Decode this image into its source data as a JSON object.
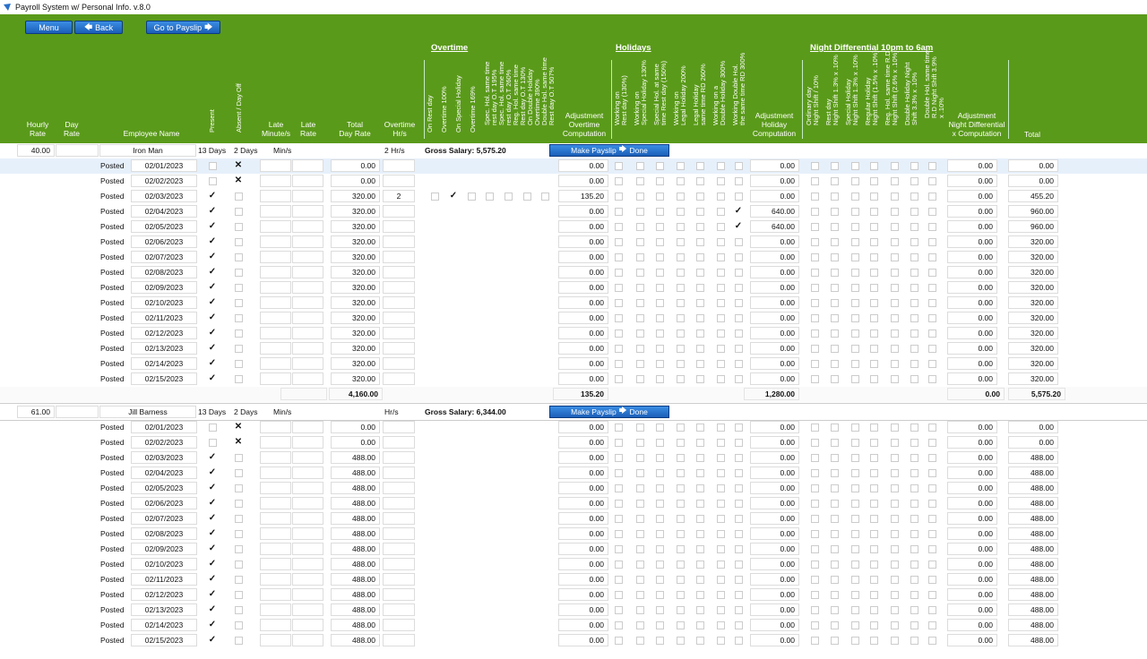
{
  "window": {
    "title": "Payroll System w/ Personal Info. v.8.0"
  },
  "nav": {
    "menu": "Menu",
    "back": "Back",
    "payslip": "Go to Payslip"
  },
  "header": {
    "cols": {
      "hourly": "Hourly\nRate",
      "day": "Day\nRate",
      "name": "Employee Name",
      "present": "Present",
      "absent": "Absent / Day Off",
      "late_min": "Late\nMinute/s",
      "late_rate": "Late\nRate",
      "total_day": "Total\nDay Rate",
      "ot_hrs": "Overtime\nHr/s",
      "adj_ot": "Adjustment\nOvertime\nComputation",
      "adj_hol": "Adjustment\nHoliday\nComputation",
      "adj_nd": "Adjustment\nNight Differential\nx Computation",
      "total": "Total"
    },
    "sections": {
      "overtime": "Overtime",
      "holidays": "Holidays",
      "night": "Night Differential 10pm to 6am"
    },
    "ot_rot": [
      [
        "On Rest day"
      ],
      [
        "Overtime 100%"
      ],
      [
        "On Special Holiday"
      ],
      [
        "Overtime 169%"
      ],
      [
        "Spec. Hol. same time",
        "rest day O.T 195%"
      ],
      [
        "Spec. Hol. same time",
        "rest day O.T 260%"
      ],
      [
        "Reg. Hol. same time",
        "Rest day O.T 130%"
      ],
      [
        "On Double Holiday",
        "Overtime 390%"
      ],
      [
        "Double Hol. same time",
        "Rest day O.T 507%"
      ]
    ],
    "hol_rot": [
      [
        "Working on",
        "Rest day (130%)"
      ],
      [
        "Working on",
        "Special Holiday 130%"
      ],
      [
        "Special Hol. at same",
        "time Rest day (150%)"
      ],
      [
        "Working on",
        "Legal Holiday 200%"
      ],
      [
        "Legal Holiday",
        "same time RD 260%"
      ],
      [
        "Working on a",
        "Double Holiday 300%"
      ],
      [
        "Working Double Hol.",
        "the same time RD 300%"
      ]
    ],
    "nd_rot": [
      [
        "Ordinary day",
        "Night Shift / 10%"
      ],
      [
        "Rest day",
        "Night Shift 1.3% x .10%"
      ],
      [
        "Special Holiday",
        "Night Shift 1.3% x .10%"
      ],
      [
        "Regular Holiday",
        "Night Shift (1.5% x .10%)"
      ],
      [
        "Reg. Hol. same time R.D",
        "Night Shift (2.6% x .10%)"
      ],
      [
        "Double Holiday Night",
        "Shift 3.3% x .10%"
      ],
      [
        "Double Hol. same time",
        "R.D Night Shift 3.9%",
        "x .10%"
      ]
    ]
  },
  "employees": [
    {
      "hourly": "40.00",
      "day_rate": "",
      "name": "Iron Man",
      "present_count": "13 Days",
      "absent_count": "2 Days",
      "late_unit": "Min/s",
      "ot_hrs": "2 Hr/s",
      "gross": "Gross Salary: 5,575.20",
      "make_payslip": "Make Payslip",
      "done": "Done",
      "rows": [
        {
          "status": "Posted",
          "date": "02/01/2023",
          "present": false,
          "absent": true,
          "day": "0.00",
          "ot": "",
          "ot_checks": [],
          "adj_ot": "0.00",
          "hol": [],
          "adj_hol": "0.00",
          "adj_nd": "0.00",
          "total": "0.00"
        },
        {
          "status": "Posted",
          "date": "02/02/2023",
          "present": false,
          "absent": true,
          "day": "0.00",
          "ot": "",
          "ot_checks": [],
          "adj_ot": "0.00",
          "hol": [],
          "adj_hol": "0.00",
          "adj_nd": "0.00",
          "total": "0.00"
        },
        {
          "status": "Posted",
          "date": "02/03/2023",
          "present": true,
          "absent": false,
          "day": "320.00",
          "ot": "2",
          "ot_checks": [
            1
          ],
          "adj_ot": "135.20",
          "hol": [],
          "adj_hol": "0.00",
          "adj_nd": "0.00",
          "total": "455.20"
        },
        {
          "status": "Posted",
          "date": "02/04/2023",
          "present": true,
          "absent": false,
          "day": "320.00",
          "ot": "",
          "ot_checks": [],
          "adj_ot": "0.00",
          "hol": [
            6
          ],
          "adj_hol": "640.00",
          "adj_nd": "0.00",
          "total": "960.00"
        },
        {
          "status": "Posted",
          "date": "02/05/2023",
          "present": true,
          "absent": false,
          "day": "320.00",
          "ot": "",
          "ot_checks": [],
          "adj_ot": "0.00",
          "hol": [
            6
          ],
          "adj_hol": "640.00",
          "adj_nd": "0.00",
          "total": "960.00"
        },
        {
          "status": "Posted",
          "date": "02/06/2023",
          "present": true,
          "absent": false,
          "day": "320.00",
          "ot": "",
          "ot_checks": [],
          "adj_ot": "0.00",
          "hol": [],
          "adj_hol": "0.00",
          "adj_nd": "0.00",
          "total": "320.00"
        },
        {
          "status": "Posted",
          "date": "02/07/2023",
          "present": true,
          "absent": false,
          "day": "320.00",
          "ot": "",
          "ot_checks": [],
          "adj_ot": "0.00",
          "hol": [],
          "adj_hol": "0.00",
          "adj_nd": "0.00",
          "total": "320.00"
        },
        {
          "status": "Posted",
          "date": "02/08/2023",
          "present": true,
          "absent": false,
          "day": "320.00",
          "ot": "",
          "ot_checks": [],
          "adj_ot": "0.00",
          "hol": [],
          "adj_hol": "0.00",
          "adj_nd": "0.00",
          "total": "320.00"
        },
        {
          "status": "Posted",
          "date": "02/09/2023",
          "present": true,
          "absent": false,
          "day": "320.00",
          "ot": "",
          "ot_checks": [],
          "adj_ot": "0.00",
          "hol": [],
          "adj_hol": "0.00",
          "adj_nd": "0.00",
          "total": "320.00"
        },
        {
          "status": "Posted",
          "date": "02/10/2023",
          "present": true,
          "absent": false,
          "day": "320.00",
          "ot": "",
          "ot_checks": [],
          "adj_ot": "0.00",
          "hol": [],
          "adj_hol": "0.00",
          "adj_nd": "0.00",
          "total": "320.00"
        },
        {
          "status": "Posted",
          "date": "02/11/2023",
          "present": true,
          "absent": false,
          "day": "320.00",
          "ot": "",
          "ot_checks": [],
          "adj_ot": "0.00",
          "hol": [],
          "adj_hol": "0.00",
          "adj_nd": "0.00",
          "total": "320.00"
        },
        {
          "status": "Posted",
          "date": "02/12/2023",
          "present": true,
          "absent": false,
          "day": "320.00",
          "ot": "",
          "ot_checks": [],
          "adj_ot": "0.00",
          "hol": [],
          "adj_hol": "0.00",
          "adj_nd": "0.00",
          "total": "320.00"
        },
        {
          "status": "Posted",
          "date": "02/13/2023",
          "present": true,
          "absent": false,
          "day": "320.00",
          "ot": "",
          "ot_checks": [],
          "adj_ot": "0.00",
          "hol": [],
          "adj_hol": "0.00",
          "adj_nd": "0.00",
          "total": "320.00"
        },
        {
          "status": "Posted",
          "date": "02/14/2023",
          "present": true,
          "absent": false,
          "day": "320.00",
          "ot": "",
          "ot_checks": [],
          "adj_ot": "0.00",
          "hol": [],
          "adj_hol": "0.00",
          "adj_nd": "0.00",
          "total": "320.00"
        },
        {
          "status": "Posted",
          "date": "02/15/2023",
          "present": true,
          "absent": false,
          "day": "320.00",
          "ot": "",
          "ot_checks": [],
          "adj_ot": "0.00",
          "hol": [],
          "adj_hol": "0.00",
          "adj_nd": "0.00",
          "total": "320.00"
        }
      ],
      "totals": {
        "day": "4,160.00",
        "ot": "135.20",
        "hol": "1,280.00",
        "nd": "0.00",
        "total": "5,575.20"
      }
    },
    {
      "hourly": "61.00",
      "day_rate": "",
      "name": "Jill Barness",
      "present_count": "13 Days",
      "absent_count": "2 Days",
      "late_unit": "Min/s",
      "ot_hrs": "Hr/s",
      "gross": "Gross Salary: 6,344.00",
      "make_payslip": "Make Payslip",
      "done": "Done",
      "rows": [
        {
          "status": "Posted",
          "date": "02/01/2023",
          "present": false,
          "absent": true,
          "day": "0.00",
          "ot": "",
          "ot_checks": [],
          "adj_ot": "0.00",
          "hol": [],
          "adj_hol": "0.00",
          "adj_nd": "0.00",
          "total": "0.00"
        },
        {
          "status": "Posted",
          "date": "02/02/2023",
          "present": false,
          "absent": true,
          "day": "0.00",
          "ot": "",
          "ot_checks": [],
          "adj_ot": "0.00",
          "hol": [],
          "adj_hol": "0.00",
          "adj_nd": "0.00",
          "total": "0.00"
        },
        {
          "status": "Posted",
          "date": "02/03/2023",
          "present": true,
          "absent": false,
          "day": "488.00",
          "ot": "",
          "ot_checks": [],
          "adj_ot": "0.00",
          "hol": [],
          "adj_hol": "0.00",
          "adj_nd": "0.00",
          "total": "488.00"
        },
        {
          "status": "Posted",
          "date": "02/04/2023",
          "present": true,
          "absent": false,
          "day": "488.00",
          "ot": "",
          "ot_checks": [],
          "adj_ot": "0.00",
          "hol": [],
          "adj_hol": "0.00",
          "adj_nd": "0.00",
          "total": "488.00"
        },
        {
          "status": "Posted",
          "date": "02/05/2023",
          "present": true,
          "absent": false,
          "day": "488.00",
          "ot": "",
          "ot_checks": [],
          "adj_ot": "0.00",
          "hol": [],
          "adj_hol": "0.00",
          "adj_nd": "0.00",
          "total": "488.00"
        },
        {
          "status": "Posted",
          "date": "02/06/2023",
          "present": true,
          "absent": false,
          "day": "488.00",
          "ot": "",
          "ot_checks": [],
          "adj_ot": "0.00",
          "hol": [],
          "adj_hol": "0.00",
          "adj_nd": "0.00",
          "total": "488.00"
        },
        {
          "status": "Posted",
          "date": "02/07/2023",
          "present": true,
          "absent": false,
          "day": "488.00",
          "ot": "",
          "ot_checks": [],
          "adj_ot": "0.00",
          "hol": [],
          "adj_hol": "0.00",
          "adj_nd": "0.00",
          "total": "488.00"
        },
        {
          "status": "Posted",
          "date": "02/08/2023",
          "present": true,
          "absent": false,
          "day": "488.00",
          "ot": "",
          "ot_checks": [],
          "adj_ot": "0.00",
          "hol": [],
          "adj_hol": "0.00",
          "adj_nd": "0.00",
          "total": "488.00"
        },
        {
          "status": "Posted",
          "date": "02/09/2023",
          "present": true,
          "absent": false,
          "day": "488.00",
          "ot": "",
          "ot_checks": [],
          "adj_ot": "0.00",
          "hol": [],
          "adj_hol": "0.00",
          "adj_nd": "0.00",
          "total": "488.00"
        },
        {
          "status": "Posted",
          "date": "02/10/2023",
          "present": true,
          "absent": false,
          "day": "488.00",
          "ot": "",
          "ot_checks": [],
          "adj_ot": "0.00",
          "hol": [],
          "adj_hol": "0.00",
          "adj_nd": "0.00",
          "total": "488.00"
        },
        {
          "status": "Posted",
          "date": "02/11/2023",
          "present": true,
          "absent": false,
          "day": "488.00",
          "ot": "",
          "ot_checks": [],
          "adj_ot": "0.00",
          "hol": [],
          "adj_hol": "0.00",
          "adj_nd": "0.00",
          "total": "488.00"
        },
        {
          "status": "Posted",
          "date": "02/12/2023",
          "present": true,
          "absent": false,
          "day": "488.00",
          "ot": "",
          "ot_checks": [],
          "adj_ot": "0.00",
          "hol": [],
          "adj_hol": "0.00",
          "adj_nd": "0.00",
          "total": "488.00"
        },
        {
          "status": "Posted",
          "date": "02/13/2023",
          "present": true,
          "absent": false,
          "day": "488.00",
          "ot": "",
          "ot_checks": [],
          "adj_ot": "0.00",
          "hol": [],
          "adj_hol": "0.00",
          "adj_nd": "0.00",
          "total": "488.00"
        },
        {
          "status": "Posted",
          "date": "02/14/2023",
          "present": true,
          "absent": false,
          "day": "488.00",
          "ot": "",
          "ot_checks": [],
          "adj_ot": "0.00",
          "hol": [],
          "adj_hol": "0.00",
          "adj_nd": "0.00",
          "total": "488.00"
        },
        {
          "status": "Posted",
          "date": "02/15/2023",
          "present": true,
          "absent": false,
          "day": "488.00",
          "ot": "",
          "ot_checks": [],
          "adj_ot": "0.00",
          "hol": [],
          "adj_hol": "0.00",
          "adj_nd": "0.00",
          "total": "488.00"
        }
      ]
    }
  ],
  "colors": {
    "header_bg": "#5a9a1a",
    "button_blue": "#1b5fb8",
    "row_highlight": "#e6f0fb"
  }
}
